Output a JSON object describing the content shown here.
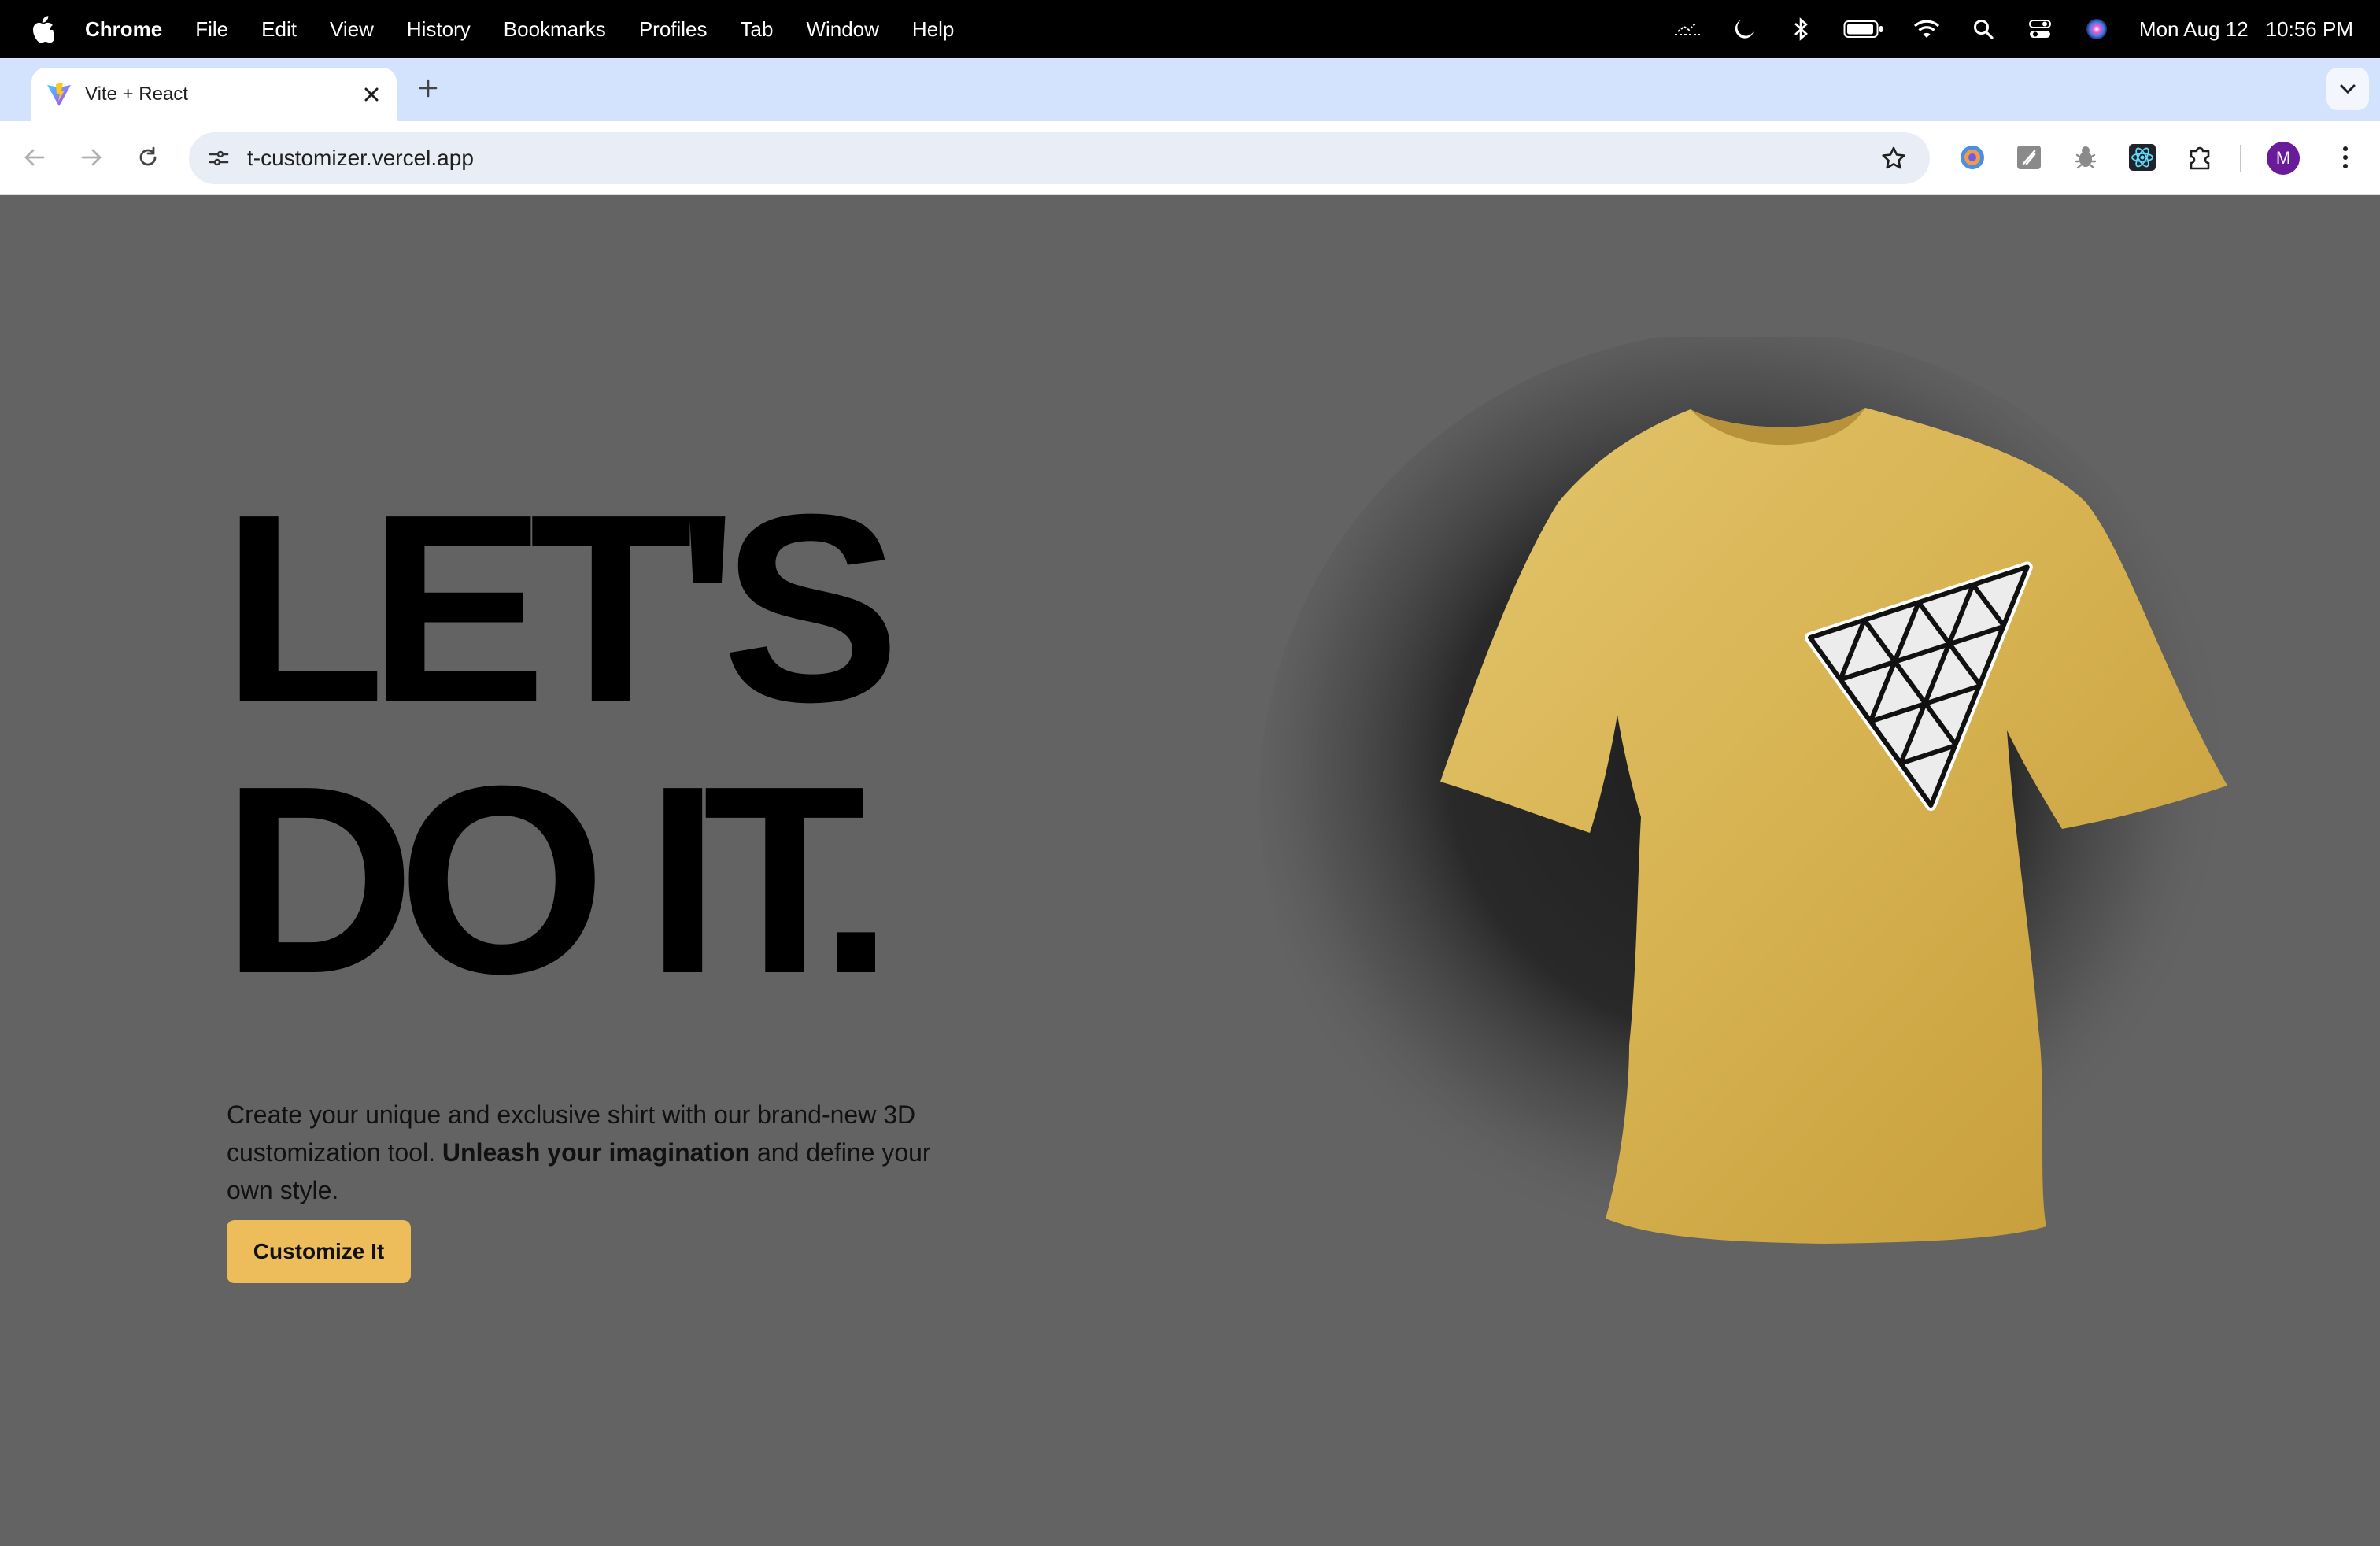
{
  "menubar": {
    "app_name": "Chrome",
    "items": [
      "File",
      "Edit",
      "View",
      "History",
      "Bookmarks",
      "Profiles",
      "Tab",
      "Window",
      "Help"
    ],
    "date": "Mon Aug 12",
    "time": "10:56 PM",
    "status_icons": [
      "activity-icon",
      "moon-icon",
      "bluetooth-icon",
      "battery-icon",
      "wifi-icon",
      "search-icon",
      "control-center-icon",
      "siri-icon"
    ]
  },
  "browser": {
    "tab_title": "Vite + React",
    "url": "t-customizer.vercel.app",
    "profile_initial": "M",
    "extensions": [
      "color-extension-icon",
      "notes-extension-icon",
      "bug-extension-icon",
      "react-devtools-icon",
      "puzzle-icon"
    ]
  },
  "hero": {
    "line1": "LET'S",
    "line2": "DO IT.",
    "description_part1": "Create your unique and exclusive shirt with our brand-new 3D customization tool. ",
    "description_bold": "Unleash your imagination",
    "description_part2": " and define your own style.",
    "cta_label": "Customize It"
  },
  "colors": {
    "background": "#636363",
    "shirt": "#d9b54f",
    "accent": "#edbd5b",
    "tab_strip": "#d3e3fd"
  }
}
